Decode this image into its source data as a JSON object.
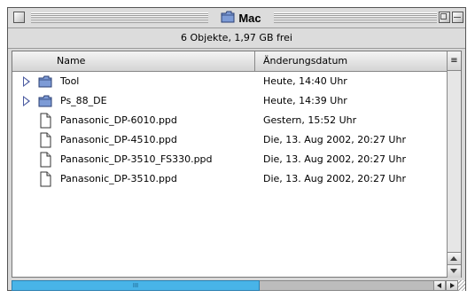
{
  "window": {
    "title": "Mac",
    "title_icon": "folder-icon"
  },
  "infobar": {
    "text": "6 Objekte, 1,97 GB frei"
  },
  "columns": {
    "name": "Name",
    "date": "Änderungsdatum",
    "sort_glyph": "≡"
  },
  "rows": [
    {
      "kind": "folder",
      "name": "Tool",
      "date": "Heute, 14:40 Uhr"
    },
    {
      "kind": "folder",
      "name": "Ps_88_DE",
      "date": "Heute, 14:39 Uhr"
    },
    {
      "kind": "file",
      "name": "Panasonic_DP-6010.ppd",
      "date": "Gestern, 15:52 Uhr"
    },
    {
      "kind": "file",
      "name": "Panasonic_DP-4510.ppd",
      "date": "Die, 13. Aug 2002, 20:27 Uhr"
    },
    {
      "kind": "file",
      "name": "Panasonic_DP-3510_FS330.ppd",
      "date": "Die, 13. Aug 2002, 20:27 Uhr"
    },
    {
      "kind": "file",
      "name": "Panasonic_DP-3510.ppd",
      "date": "Die, 13. Aug 2002, 20:27 Uhr"
    }
  ],
  "colors": {
    "scroll_thumb": "#48b4e8",
    "folder": "#7d9bd6",
    "disclosure": "#4a5aa0"
  },
  "hscroll": {
    "thumb_grip": "III"
  }
}
